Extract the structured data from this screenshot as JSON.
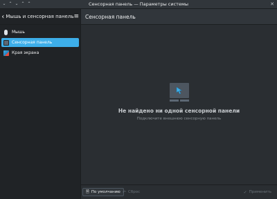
{
  "window": {
    "title": "Сенсорная панель — Параметры системы",
    "controls": [
      "⌄",
      "⌃",
      "⌄",
      "⌃",
      "⌃"
    ],
    "close": "✕"
  },
  "sidebar": {
    "back_icon": "‹",
    "title": "Мышь и сенсорная панель",
    "menu_icon": "≡",
    "items": [
      {
        "label": "Мышь",
        "icon": "mouse-icon",
        "active": false
      },
      {
        "label": "Сенсорная панель",
        "icon": "touchpad-icon",
        "active": true
      },
      {
        "label": "Края экрана",
        "icon": "screen-edges-icon",
        "active": false
      }
    ]
  },
  "main": {
    "title": "Сенсорная панель",
    "empty_title": "Не найдено ни одной сенсорной панели",
    "empty_subtitle": "Подключите внешнюю сенсорную панель"
  },
  "footer": {
    "defaults_label": "По умолчанию",
    "reset_label": "Сброс",
    "apply_label": "Применить"
  },
  "colors": {
    "accent": "#3daee9",
    "background": "#2a2e32",
    "sidebar": "#202326"
  }
}
